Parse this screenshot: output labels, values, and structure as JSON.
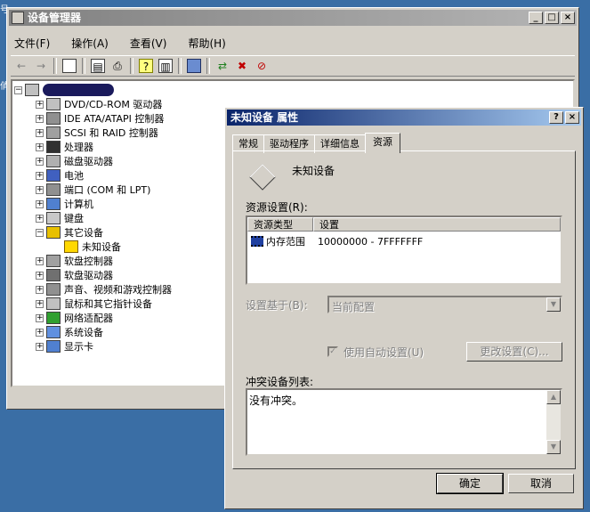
{
  "desktop_edge_glyphs": [
    "号",
    "俏"
  ],
  "device_manager": {
    "title": "设备管理器",
    "menu": [
      {
        "label": "文件(F)"
      },
      {
        "label": "操作(A)"
      },
      {
        "label": "查看(V)"
      },
      {
        "label": "帮助(H)"
      }
    ],
    "toolbar_icons": [
      "back-arrow-icon",
      "forward-arrow-icon",
      "show-hide-tree-icon",
      "properties-icon",
      "print-icon",
      "help-icon",
      "export-list-icon",
      "scan-hardware-icon",
      "update-driver-icon",
      "uninstall-icon",
      "disable-icon"
    ],
    "tree": {
      "root_expander": "⊟",
      "collapsed_expander": "+",
      "expanded_expander": "−",
      "categories": [
        {
          "label": "DVD/CD-ROM 驱动器",
          "icon": "cdrom-icon"
        },
        {
          "label": "IDE ATA/ATAPI 控制器",
          "icon": "ide-controller-icon"
        },
        {
          "label": "SCSI 和 RAID 控制器",
          "icon": "scsi-icon"
        },
        {
          "label": "处理器",
          "icon": "processor-icon"
        },
        {
          "label": "磁盘驱动器",
          "icon": "disk-icon"
        },
        {
          "label": "电池",
          "icon": "battery-icon"
        },
        {
          "label": "端口 (COM 和 LPT)",
          "icon": "port-icon"
        },
        {
          "label": "计算机",
          "icon": "computer-icon"
        },
        {
          "label": "键盘",
          "icon": "keyboard-icon"
        },
        {
          "label": "其它设备",
          "icon": "unknown-device-icon",
          "expanded": true,
          "children": [
            {
              "label": "未知设备",
              "icon": "warning-device-icon"
            }
          ]
        },
        {
          "label": "软盘控制器",
          "icon": "floppy-controller-icon"
        },
        {
          "label": "软盘驱动器",
          "icon": "floppy-drive-icon"
        },
        {
          "label": "声音、视频和游戏控制器",
          "icon": "sound-icon"
        },
        {
          "label": "鼠标和其它指针设备",
          "icon": "mouse-icon"
        },
        {
          "label": "网络适配器",
          "icon": "network-icon"
        },
        {
          "label": "系统设备",
          "icon": "system-device-icon"
        },
        {
          "label": "显示卡",
          "icon": "display-adapter-icon"
        }
      ]
    }
  },
  "properties_dialog": {
    "title": "未知设备 属性",
    "help_button": "?",
    "close_button": "×",
    "tabs": [
      {
        "label": "常规"
      },
      {
        "label": "驱动程序"
      },
      {
        "label": "详细信息"
      },
      {
        "label": "资源",
        "active": true
      }
    ],
    "device_name": "未知设备",
    "resource_settings_label": "资源设置(R):",
    "resource_table": {
      "headers": [
        "资源类型",
        "设置"
      ],
      "rows": [
        {
          "type": "内存范围",
          "setting": "10000000 - 7FFFFFFF",
          "icon": "memory-chip-icon"
        }
      ]
    },
    "setting_based_on_label": "设置基于(B):",
    "setting_based_on_value": "当前配置",
    "use_automatic_settings_label": "使用自动设置(U)",
    "use_automatic_settings_checked": true,
    "change_setting_button": "更改设置(C)...",
    "conflict_list_label": "冲突设备列表:",
    "conflict_text": "没有冲突。",
    "ok_button": "确定",
    "cancel_button": "取消"
  },
  "colors": {
    "desktop": "#3a6ea5",
    "active_title": "#0a246a",
    "inactive_title": "#808080",
    "face": "#d4d0c8"
  }
}
